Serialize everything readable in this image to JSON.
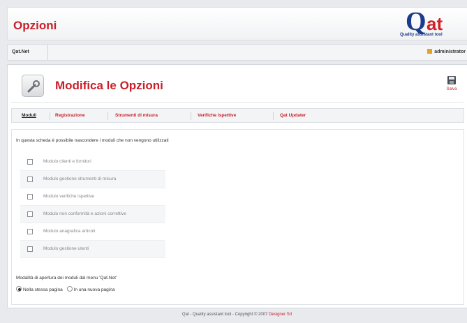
{
  "app": {
    "title": "Opzioni",
    "logo_q": "Q",
    "logo_at": "at",
    "logo_tag_a": "Quality",
    "logo_tag_b": "assistant tool"
  },
  "breadcrumb": {
    "item": "Qat.Net",
    "user": "administrator"
  },
  "page": {
    "title": "Modifica le Opzioni",
    "save_label": "Salva"
  },
  "tabs": [
    {
      "label": "Moduli",
      "active": true
    },
    {
      "label": "Registrazione"
    },
    {
      "label": "Strumenti di misura"
    },
    {
      "label": "Verifiche ispettive"
    },
    {
      "label": "Qat Updater"
    }
  ],
  "content": {
    "intro": "In questa scheda è possibile nascondere i moduli che non vengono utilizzati",
    "modules": [
      {
        "label": "Modulo clienti e fornitori",
        "checked": false
      },
      {
        "label": "Modulo gestione strumenti di misura",
        "checked": false
      },
      {
        "label": "Modulo verifiche ispettive",
        "checked": false
      },
      {
        "label": "Modulo non conformità e azioni correttive",
        "checked": false
      },
      {
        "label": "Modulo anagrafica articoli",
        "checked": false
      },
      {
        "label": "Modulo gestione utenti",
        "checked": false
      }
    ],
    "opening_label": "Modalità di apertura dei moduli dal menu 'Qat.Net'",
    "radio_options": [
      {
        "label": "Nella stessa pagina",
        "checked": true
      },
      {
        "label": "In una nuova pagina",
        "checked": false
      }
    ]
  },
  "footer": {
    "text": "Qat - Quality assistant tool - Copyright © 2007",
    "link": "Designer Srl"
  },
  "colors": {
    "accent_red": "#c8202a",
    "logo_blue": "#1b3b8c"
  }
}
